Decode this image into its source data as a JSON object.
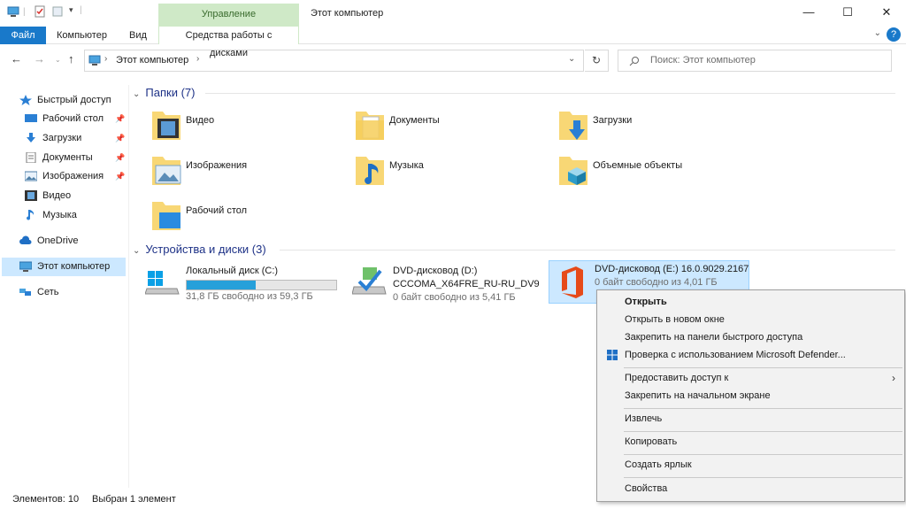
{
  "titlebar": {
    "context_tab_header": "Управление",
    "window_title": "Этот компьютер",
    "minimize": "—",
    "maximize": "☐",
    "close": "✕"
  },
  "ribbon": {
    "tabs": [
      {
        "label": "Файл"
      },
      {
        "label": "Компьютер"
      },
      {
        "label": "Вид"
      },
      {
        "label": "Средства работы с дисками"
      }
    ],
    "help": "?"
  },
  "nav": {
    "breadcrumb_root": "Этот компьютер",
    "search_placeholder": "Поиск: Этот компьютер"
  },
  "sidebar": {
    "items": [
      {
        "label": "Быстрый доступ",
        "icon": "star-icon"
      },
      {
        "label": "Рабочий стол",
        "icon": "desktop-icon",
        "pinned": true
      },
      {
        "label": "Загрузки",
        "icon": "download-icon",
        "pinned": true
      },
      {
        "label": "Документы",
        "icon": "documents-icon",
        "pinned": true
      },
      {
        "label": "Изображения",
        "icon": "pictures-icon",
        "pinned": true
      },
      {
        "label": "Видео",
        "icon": "video-icon"
      },
      {
        "label": "Музыка",
        "icon": "music-icon"
      },
      {
        "label": "OneDrive",
        "icon": "cloud-icon"
      },
      {
        "label": "Этот компьютер",
        "icon": "computer-icon",
        "selected": true
      },
      {
        "label": "Сеть",
        "icon": "network-icon"
      }
    ]
  },
  "folders_group": {
    "title": "Папки (7)",
    "items": [
      {
        "label": "Видео"
      },
      {
        "label": "Документы"
      },
      {
        "label": "Загрузки"
      },
      {
        "label": "Изображения"
      },
      {
        "label": "Музыка"
      },
      {
        "label": "Объемные объекты"
      },
      {
        "label": "Рабочий стол"
      }
    ]
  },
  "drives_group": {
    "title": "Устройства и диски (3)",
    "items": [
      {
        "name": "Локальный диск (C:)",
        "free": "31,8 ГБ свободно из 59,3 ГБ",
        "used_fraction": 0.46
      },
      {
        "name": "DVD-дисковод (D:)",
        "sub": "CCCOMA_X64FRE_RU-RU_DV9",
        "free": "0 байт свободно из 5,41 ГБ"
      },
      {
        "name": "DVD-дисковод (E:) 16.0.9029.2167",
        "free": "0 байт свободно из 4,01 ГБ"
      }
    ]
  },
  "status": {
    "count": "Элементов: 10",
    "selected": "Выбран 1 элемент"
  },
  "context_menu": {
    "items": [
      {
        "label": "Открыть"
      },
      {
        "label": "Открыть в новом окне"
      },
      {
        "label": "Закрепить на панели быстрого доступа"
      },
      {
        "label": "Проверка с использованием Microsoft Defender..."
      },
      {
        "label": "Предоставить доступ к"
      },
      {
        "label": "Закрепить на начальном экране"
      },
      {
        "label": "Извлечь"
      },
      {
        "label": "Копировать"
      },
      {
        "label": "Создать ярлык"
      },
      {
        "label": "Свойства"
      }
    ]
  },
  "colors": {
    "accent": "#1979ca",
    "selection": "#cce8ff",
    "context_tab": "#cfe9c7",
    "folder_yellow": "#f8d775"
  }
}
